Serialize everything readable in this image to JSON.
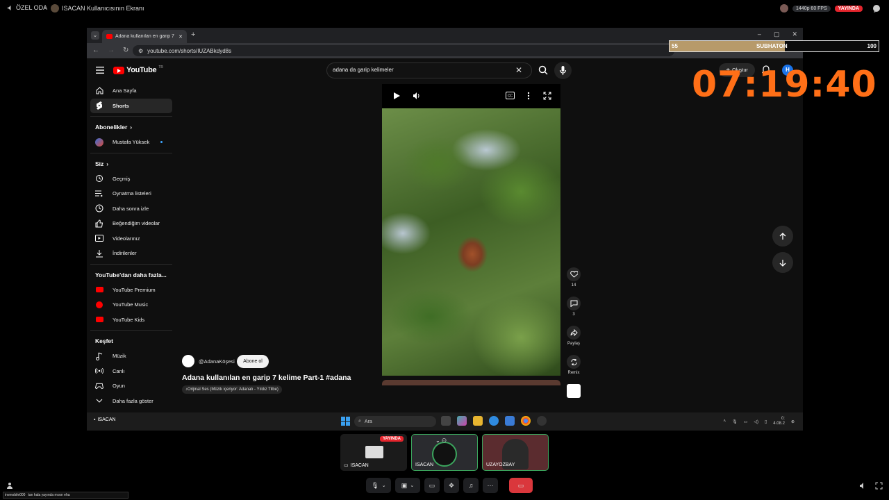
{
  "topbar": {
    "room_name": "ÖZEL ODA",
    "stream_title": "ISACAN Kullanıcısının Ekranı",
    "quality": "1440p 60 FPS",
    "live_label": "YAYINDA"
  },
  "browser": {
    "tab_title": "Adana kullanılan en garip 7 kel",
    "url": "youtube.com/shorts/IUZABkdyd8s"
  },
  "youtube": {
    "logo_text": "YouTube",
    "country_code": "TR",
    "search_query": "adana da garip kelimeler",
    "create_label": "Oluştur",
    "account_initial": "H",
    "sidebar": {
      "home": "Ana Sayfa",
      "shorts": "Shorts",
      "subs_header": "Abonelikler",
      "sub_channel": "Mustafa Yüksek",
      "you_header": "Siz",
      "history": "Geçmiş",
      "playlists": "Oynatma listeleri",
      "watch_later": "Daha sonra izle",
      "liked": "Beğendiğim videolar",
      "your_videos": "Videolarınız",
      "downloads": "İndirilenler",
      "more_header": "YouTube'dan daha fazla...",
      "premium": "YouTube Premium",
      "music": "YouTube Music",
      "kids": "YouTube Kids",
      "explore_header": "Keşfet",
      "music_cat": "Müzik",
      "live": "Canlı",
      "gaming": "Oyun",
      "show_more": "Daha fazla göster"
    },
    "short": {
      "channel": "@AdanaKöşesi",
      "subscribe": "Abone ol",
      "title": "Adana kullanılan en garip 7 kelime Part-1 #adana",
      "audio": "Orijinal Ses (Müzik içeriyor: Adanalı - Yıldız Tilbe)",
      "likes": "14",
      "comments": "3",
      "share": "Paylaş",
      "remix": "Remix",
      "progress_fraction": 0.38
    }
  },
  "taskbar": {
    "search_placeholder": "Ara",
    "time": "0:",
    "date": "4.08.2"
  },
  "screen_label": "ISACAN",
  "overlay": {
    "left": "55",
    "label": "SUBHATON",
    "right": "100",
    "fill_fraction": 0.55,
    "timer": "07:19:40",
    "timer_color": "#ff6f17"
  },
  "participants": [
    {
      "name": "ISACAN",
      "live": "YAYINDA"
    },
    {
      "name": "ISACAN"
    },
    {
      "name": "UZAYOZBAY"
    }
  ],
  "chat": {
    "user": "invmobile000",
    "message": "tan hala yayında mısın eha"
  }
}
